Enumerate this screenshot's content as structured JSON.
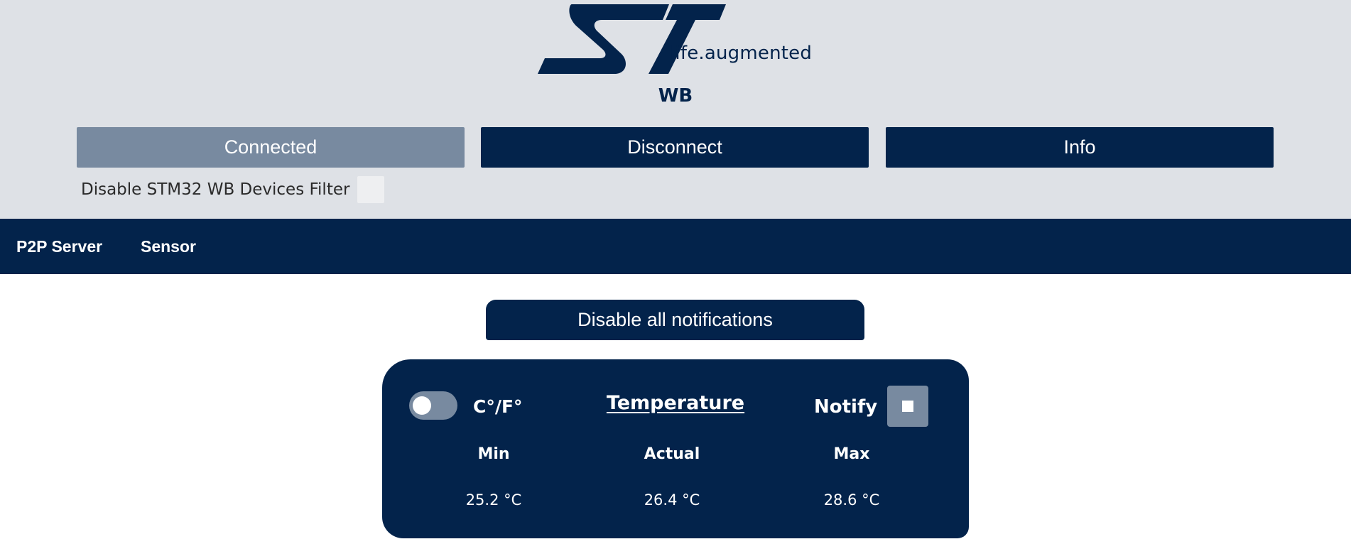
{
  "header": {
    "logo_text": "ST",
    "tagline": "life.augmented",
    "product": "WB"
  },
  "buttons": {
    "connected": "Connected",
    "disconnect": "Disconnect",
    "info": "Info"
  },
  "filter": {
    "label": "Disable STM32 WB Devices Filter",
    "checked": false
  },
  "nav": {
    "tabs": [
      "P2P Server",
      "Sensor"
    ]
  },
  "notifications": {
    "disable_all_label": "Disable all notifications"
  },
  "temperature_card": {
    "unit_toggle_label": "C°/F°",
    "unit_toggle_on": false,
    "title": "Temperature",
    "notify_label": "Notify",
    "columns": [
      {
        "label": "Min",
        "value": "25.2 °C"
      },
      {
        "label": "Actual",
        "value": "26.4 °C"
      },
      {
        "label": "Max",
        "value": "28.6 °C"
      }
    ]
  },
  "colors": {
    "navy": "#03234b",
    "muted_blue": "#788aa0",
    "header_bg": "#dee1e6"
  }
}
